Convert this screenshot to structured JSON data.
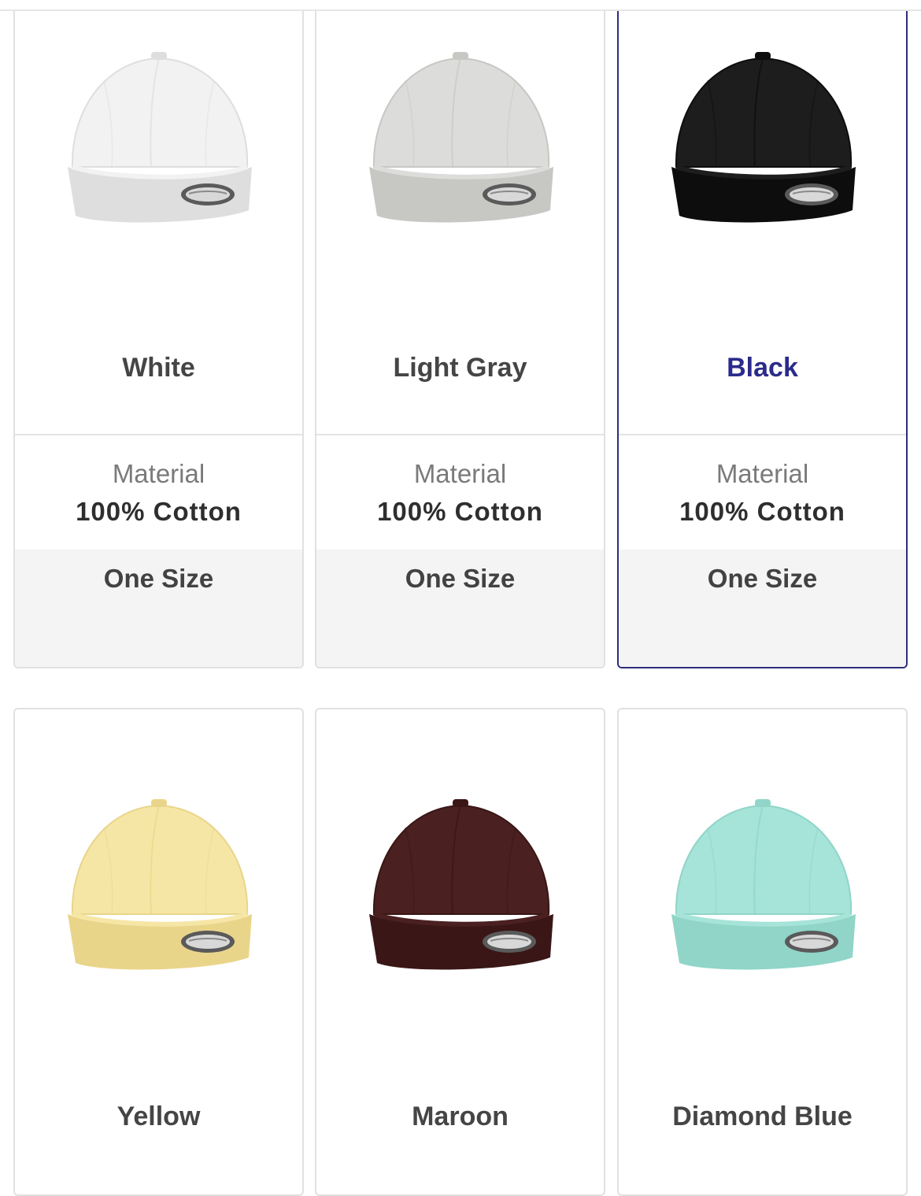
{
  "cards": [
    {
      "name": "White",
      "material_label": "Material",
      "material_value": "100% Cotton",
      "size": "One Size",
      "color": "#f2f2f2",
      "shade": "#dedede",
      "selected": false
    },
    {
      "name": "Light Gray",
      "material_label": "Material",
      "material_value": "100% Cotton",
      "size": "One Size",
      "color": "#dcdcda",
      "shade": "#c7c7c4",
      "selected": false
    },
    {
      "name": "Black",
      "material_label": "Material",
      "material_value": "100% Cotton",
      "size": "One Size",
      "color": "#1d1d1d",
      "shade": "#0d0d0d",
      "selected": true
    },
    {
      "name": "Yellow",
      "color": "#f6e6a6",
      "shade": "#e9d58a",
      "selected": false
    },
    {
      "name": "Maroon",
      "color": "#4a2020",
      "shade": "#3a1616",
      "selected": false
    },
    {
      "name": "Diamond Blue",
      "color": "#a6e3d8",
      "shade": "#90d5c8",
      "selected": false
    }
  ],
  "colors": {
    "accent": "#2e2e7a",
    "selected_text": "#2b2b8c",
    "card_border": "#e1e1e1",
    "size_band": "#f4f4f4"
  },
  "icons": {
    "cap_image": "baseball-cap-icon"
  }
}
